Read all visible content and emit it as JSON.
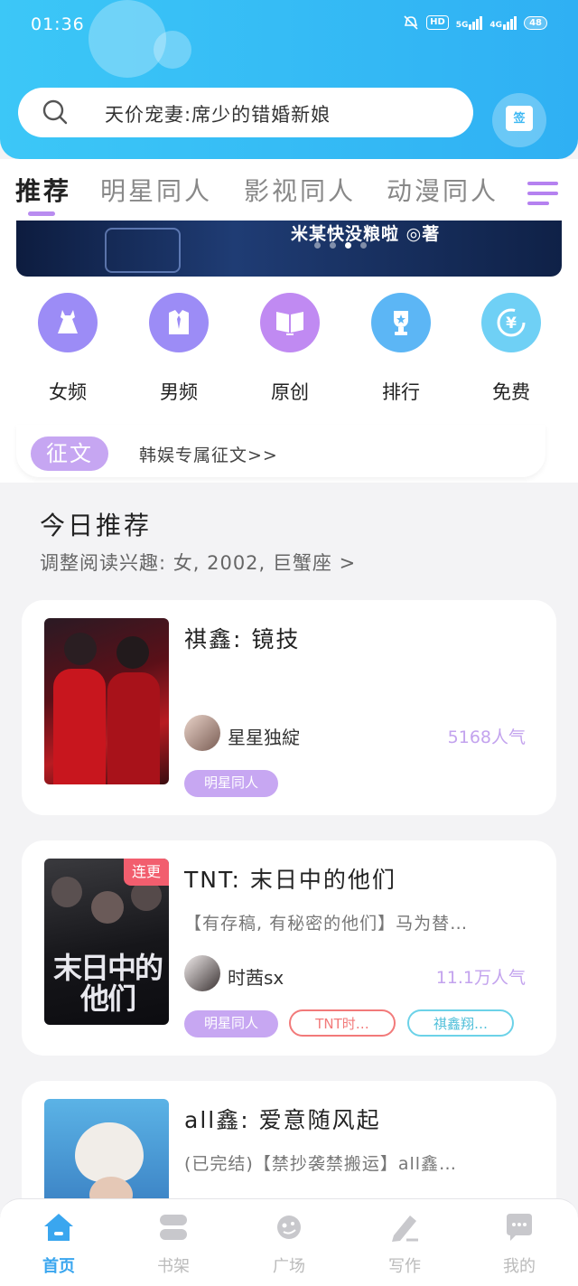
{
  "status_bar": {
    "time": "01:36",
    "hd_label": "HD",
    "net_5g": "5G",
    "net_4g": "4G",
    "battery": "48"
  },
  "search": {
    "placeholder": "天价宠妻:席少的错婚新娘",
    "signin_label": "签"
  },
  "tabs": [
    {
      "label": "推荐",
      "active": true
    },
    {
      "label": "明星同人",
      "active": false
    },
    {
      "label": "影视同人",
      "active": false
    },
    {
      "label": "动漫同人",
      "active": false
    }
  ],
  "banner": {
    "text": "米某快没粮啦 ◎著"
  },
  "categories": [
    {
      "label": "女频",
      "icon": "dress-icon",
      "color": "#9c8cf6"
    },
    {
      "label": "男频",
      "icon": "shirt-icon",
      "color": "#9c8cf6"
    },
    {
      "label": "原创",
      "icon": "book-icon",
      "color": "#c08af2"
    },
    {
      "label": "排行",
      "icon": "trophy-icon",
      "color": "#5cb6f5"
    },
    {
      "label": "免费",
      "icon": "yen-coin-icon",
      "color": "#6fd0f5"
    }
  ],
  "notice": {
    "tag": "征文",
    "text": "韩娱专属征文>>"
  },
  "recommend": {
    "title": "今日推荐",
    "subtitle": "调整阅读兴趣: 女, 2002, 巨蟹座 >"
  },
  "books": [
    {
      "title": "祺鑫: 镜技",
      "desc": "",
      "author": "星星独綻",
      "popularity": "5168人气",
      "badges": [
        {
          "label": "明星同人",
          "style": "purple"
        }
      ],
      "corner_tag": ""
    },
    {
      "title": "TNT: 末日中的他们",
      "desc": "【有存稿, 有秘密的他们】马为替…",
      "author": "时茜sx",
      "popularity": "11.1万人气",
      "badges": [
        {
          "label": "明星同人",
          "style": "purple"
        },
        {
          "label": "TNT时…",
          "style": "red"
        },
        {
          "label": "祺鑫翔…",
          "style": "cyan"
        }
      ],
      "corner_tag": "连更",
      "cover_text": "末日中的他们"
    },
    {
      "title": "all鑫: 爱意随风起",
      "desc": "(已完结)【禁抄袭禁搬运】all鑫…",
      "author": "",
      "popularity": "",
      "badges": [],
      "corner_tag": ""
    }
  ],
  "bottom_nav": [
    {
      "label": "首页",
      "icon": "home-icon",
      "active": true
    },
    {
      "label": "书架",
      "icon": "bookshelf-icon",
      "active": false
    },
    {
      "label": "广场",
      "icon": "planet-icon",
      "active": false
    },
    {
      "label": "写作",
      "icon": "pen-icon",
      "active": false
    },
    {
      "label": "我的",
      "icon": "chat-bubble-icon",
      "active": false
    }
  ],
  "colors": {
    "header_gradient_start": "#3cc7f7",
    "header_gradient_end": "#2fb0f3",
    "accent_purple": "#c7a7f2",
    "popularity_purple": "#c3a3ee",
    "nav_active": "#3aa6ef"
  }
}
